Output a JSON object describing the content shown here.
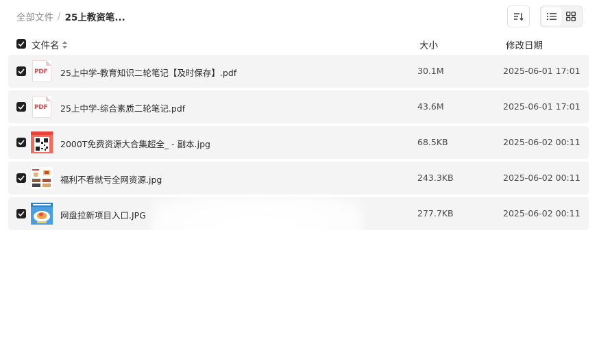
{
  "breadcrumb": {
    "root": "全部文件",
    "separator": "/",
    "current": "25上教资笔..."
  },
  "toolbar": {
    "sort_icon": "sort-lines-icon",
    "view_list_icon": "list-view-icon",
    "view_grid_icon": "grid-view-icon",
    "active_view": "grid"
  },
  "columns": {
    "name": "文件名",
    "size": "大小",
    "date": "修改日期"
  },
  "files": [
    {
      "name": "25上中学-教育知识二轮笔记【及时保存】.pdf",
      "size": "30.1M",
      "date": "2025-06-01 17:01",
      "type": "pdf",
      "thumb_label": "PDF",
      "checked": true
    },
    {
      "name": "25上中学-综合素质二轮笔记.pdf",
      "size": "43.6M",
      "date": "2025-06-01 17:01",
      "type": "pdf",
      "thumb_label": "PDF",
      "checked": true
    },
    {
      "name": "2000T免费资源大合集超全_ - 副本.jpg",
      "size": "68.5KB",
      "date": "2025-06-02 00:11",
      "type": "image-qr",
      "checked": true
    },
    {
      "name": "福利不看就亏全网资源.jpg",
      "size": "243.3KB",
      "date": "2025-06-02 00:11",
      "type": "image-poster",
      "checked": true
    },
    {
      "name": "网盘拉新项目入口.JPG",
      "size": "277.7KB",
      "date": "2025-06-02 00:11",
      "type": "image-promo",
      "checked": true
    }
  ],
  "colors": {
    "row_bg": "#f4f4f4",
    "checkbox": "#1f1f1f",
    "pdf_red": "#e5484d"
  }
}
